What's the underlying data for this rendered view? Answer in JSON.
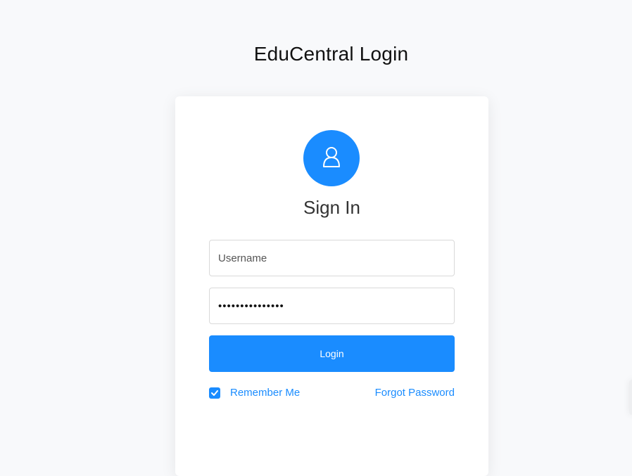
{
  "page": {
    "title": "EduCentral Login"
  },
  "card": {
    "heading": "Sign In",
    "avatar_icon": "user-icon",
    "username": {
      "placeholder": "Username",
      "value": ""
    },
    "password": {
      "value": "•••••••••••••••"
    },
    "login_label": "Login",
    "remember_label": "Remember Me",
    "remember_checked": true,
    "forgot_label": "Forgot Password"
  },
  "colors": {
    "accent": "#1a8cff",
    "background": "#f8f9fb",
    "card": "#ffffff"
  }
}
